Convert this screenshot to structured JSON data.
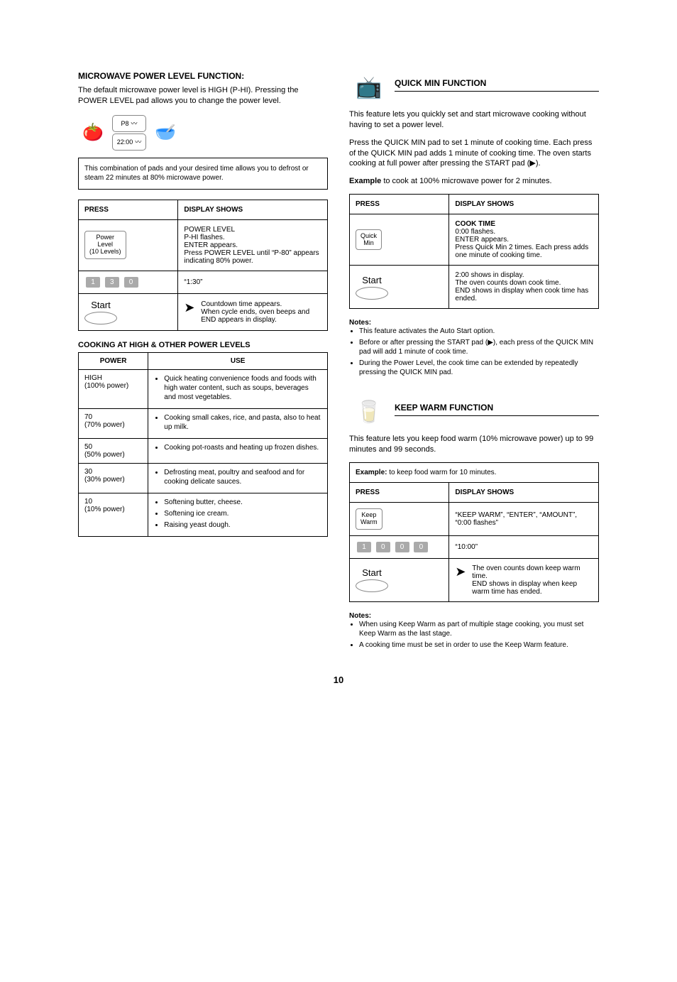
{
  "left": {
    "title": "MICROWAVE POWER LEVEL FUNCTION:",
    "intro": "The default microwave power level is HIGH (P-HI). Pressing the POWER LEVEL pad allows you to change the power level.",
    "display_labels": {
      "p8": "P8",
      "digits": "22:00"
    },
    "callout": "This combination of pads and your desired time allows you to defrost or steam 22 minutes at 80% microwave power.",
    "table": {
      "hdr_press": "PRESS",
      "hdr_disp": "DISPLAY SHOWS",
      "rows": [
        {
          "press_type": "box",
          "press_lines": [
            "Power",
            "Level",
            "(10 Levels)"
          ],
          "disp": "POWER LEVEL\nP-HI flashes.\nENTER appears.\nPress POWER LEVEL until “P-80” appears indicating 80% power."
        },
        {
          "press_type": "keys",
          "keys": [
            "1",
            "3",
            "0"
          ],
          "disp": "“1:30”"
        },
        {
          "press_type": "start",
          "disp_arrow": true,
          "disp": "Countdown time appears.\nWhen cycle ends, oven beeps and END appears in display."
        }
      ]
    },
    "power_header": "COOKING AT HIGH & OTHER POWER LEVELS",
    "power_table": {
      "hdr_p": "POWER",
      "hdr_u": "USE",
      "rows": [
        {
          "p": "HIGH\n(100% power)",
          "u": [
            "Quick heating convenience foods and foods with high water content, such as soups, beverages and most vegetables."
          ]
        },
        {
          "p": "70\n(70% power)",
          "u": [
            "Cooking small cakes, rice, and pasta, also to heat up milk."
          ]
        },
        {
          "p": "50\n(50% power)",
          "u": [
            "Cooking pot-roasts and heating up frozen dishes."
          ]
        },
        {
          "p": "30\n(30% power)",
          "u": [
            "Defrosting meat, poultry and seafood and for cooking delicate sauces."
          ]
        },
        {
          "p": "10\n(10% power)",
          "u": [
            "Softening butter, cheese.",
            "Softening ice cream.",
            "Raising yeast dough."
          ]
        }
      ]
    }
  },
  "right": {
    "quick": {
      "title": "QUICK MIN FUNCTION",
      "intro1": "This feature lets you quickly set and start microwave cooking without having to set a power level.",
      "intro2": "Press the QUICK MIN pad to set 1 minute of cooking time. Each press of the QUICK MIN pad adds 1 minute of cooking time. The oven starts cooking at full power after pressing the START pad (▶).",
      "example_lbl": "Example",
      "example_txt": "to cook at 100% microwave power for 2 minutes.",
      "table": {
        "hdr_press": "PRESS",
        "hdr_disp": "DISPLAY SHOWS",
        "rows": [
          {
            "press_type": "box",
            "press_lines": [
              "Quick",
              "Min"
            ],
            "disp_title": "COOK TIME",
            "disp": "0:00 flashes.\nENTER appears.\nPress Quick Min 2 times. Each press adds one minute of cooking time."
          },
          {
            "press_type": "start",
            "disp": "2:00 shows in display.\nThe oven counts down cook time.\nEND shows in display when cook time has ended."
          }
        ]
      },
      "notes_title": "Notes:",
      "notes": [
        "This feature activates the Auto Start option.",
        "Before or after pressing the START pad (▶), each press of the QUICK MIN pad will add 1 minute of cook time.",
        "During the Power Level, the cook time can be extended by repeatedly pressing the QUICK MIN pad."
      ]
    },
    "keepwarm": {
      "title": "KEEP WARM FUNCTION",
      "intro": "This feature lets you keep food warm (10% microwave power) up to 99 minutes and 99 seconds.",
      "example_lbl": "Example:",
      "example_txt": "to keep food warm for 10 minutes.",
      "table": {
        "hdr_press": "PRESS",
        "hdr_disp": "DISPLAY SHOWS",
        "rows": [
          {
            "press_type": "box",
            "press_lines": [
              "Keep",
              "Warm"
            ],
            "disp": "“KEEP WARM”, “ENTER”, “AMOUNT”, “0:00 flashes”"
          },
          {
            "press_type": "keys",
            "keys": [
              "1",
              "0",
              "0",
              "0"
            ],
            "disp": "“10:00”"
          },
          {
            "press_type": "start",
            "disp_arrow": true,
            "disp": "The oven counts down keep warm time.\nEND shows in display when keep warm time has ended."
          }
        ]
      },
      "notes_title": "Notes:",
      "notes": [
        "When using Keep Warm as part of multiple stage cooking, you must set Keep Warm as the last stage.",
        "A cooking time must be set in order to use the Keep Warm feature."
      ]
    }
  },
  "page_num": "10"
}
